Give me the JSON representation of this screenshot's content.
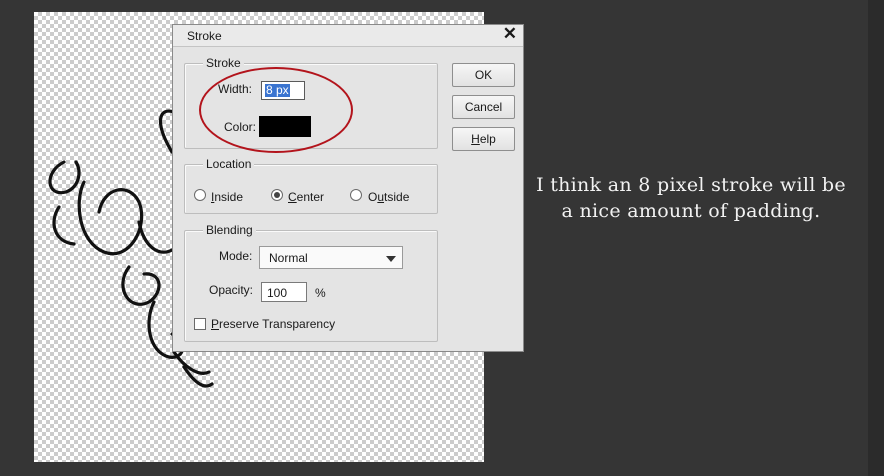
{
  "dialog": {
    "title": "Stroke",
    "stroke_group": {
      "legend": "Stroke",
      "width_label": "Width:",
      "width_value": "8 px",
      "color_label": "Color:",
      "color_value": "#000000"
    },
    "location_group": {
      "legend": "Location",
      "options": [
        {
          "label_first": "I",
          "label_rest": "nside",
          "selected": false
        },
        {
          "label_first": "C",
          "label_rest": "enter",
          "selected": true
        },
        {
          "label_pre": "O",
          "label_u": "u",
          "label_rest": "tside",
          "selected": false
        }
      ]
    },
    "blending_group": {
      "legend": "Blending",
      "mode_label": "Mode:",
      "mode_value": "Normal",
      "opacity_label": "Opacity:",
      "opacity_value": "100",
      "opacity_unit": "%",
      "preserve_first": "P",
      "preserve_rest": "reserve Transparency",
      "preserve_checked": false
    },
    "buttons": {
      "ok": "OK",
      "cancel": "Cancel",
      "help_first": "H",
      "help_rest": "elp"
    }
  },
  "caption": {
    "line1": "I think an 8 pixel stroke will be",
    "line2": "a nice amount of padding."
  },
  "colors": {
    "background": "#353535",
    "highlight_ellipse": "#b3141c",
    "selection": "#3a74d0"
  }
}
